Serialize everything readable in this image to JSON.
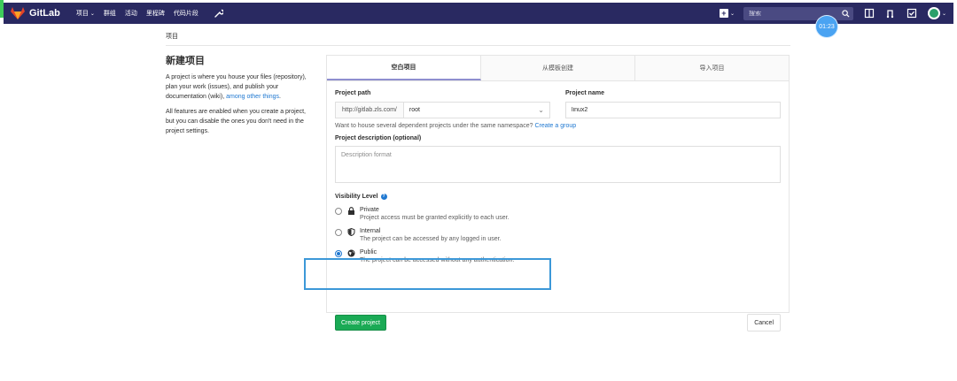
{
  "colors": {
    "navbar_bg": "#292961",
    "accent_green": "#1aaa55",
    "link_blue": "#1f78d1",
    "highlight_box": "#3c98d8",
    "timer_badge": "#4aa3f2"
  },
  "navbar": {
    "brand": "GitLab",
    "links": [
      {
        "label": "项目",
        "icon": "chevron-down-icon"
      },
      {
        "label": "群组"
      },
      {
        "label": "活动"
      },
      {
        "label": "里程碑"
      },
      {
        "label": "代码片段"
      }
    ],
    "search_placeholder": "搜索",
    "icons": [
      "plus-icon",
      "search-icon",
      "sidebar-toggle-icon",
      "merge-request-icon",
      "todo-check-icon",
      "avatar"
    ]
  },
  "timer": "01:23",
  "breadcrumb": "项目",
  "sidebar": {
    "title": "新建项目",
    "para1_text": "A project is where you house your files (repository), plan your work (issues), and publish your documentation (wiki), ",
    "para1_link": "among other things",
    "para1_end": ".",
    "para2": "All features are enabled when you create a project, but you can disable the ones you don't need in the project settings."
  },
  "tabs": [
    {
      "label": "空白项目",
      "active": true
    },
    {
      "label": "从模板创建",
      "active": false
    },
    {
      "label": "导入项目",
      "active": false
    }
  ],
  "form": {
    "path_label": "Project path",
    "path_prefix": "http://gitlab.zls.com/",
    "namespace": "root",
    "name_label": "Project name",
    "name_value": "linux2",
    "help_text": "Want to house several dependent projects under the same namespace? ",
    "help_link": "Create a group",
    "desc_label": "Project description (optional)",
    "desc_placeholder": "Description format",
    "visibility_label": "Visibility Level",
    "visibility_options": [
      {
        "title": "Private",
        "desc": "Project access must be granted explicitly to each user.",
        "icon": "lock-icon",
        "checked": false
      },
      {
        "title": "Internal",
        "desc": "The project can be accessed by any logged in user.",
        "icon": "shield-icon",
        "checked": false
      },
      {
        "title": "Public",
        "desc": "The project can be accessed without any authentication.",
        "icon": "globe-icon",
        "checked": true
      }
    ],
    "create_label": "Create project",
    "cancel_label": "Cancel"
  }
}
